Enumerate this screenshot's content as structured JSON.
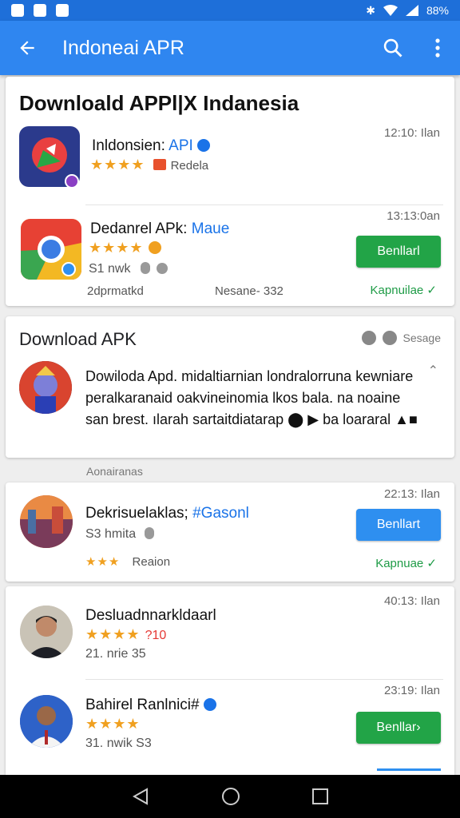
{
  "app_bar": {
    "title": "Indoneai APR"
  },
  "status": {
    "battery": "88%"
  },
  "featured": {
    "heading": "Downloald APPl|X Indanesia",
    "apps": [
      {
        "name": "Inldonsien:",
        "tag": "API",
        "time": "12:10: Ilan",
        "stars": "★★★★",
        "badge": "Redela"
      },
      {
        "name": "Dedanrel APk:",
        "tag": "Maue",
        "time": "13:13:0an",
        "stars": "★★★★",
        "meta": "S1 nwk",
        "installs": "2dprmatkd",
        "version": "Nesane- 332",
        "button": "Benllarl",
        "link": "Kapnuilae ✓"
      }
    ]
  },
  "post": {
    "title": "Download APK",
    "label": "Sesage",
    "text": "Dowiloda Apd. midaltiarnian londralorruna kewniare peralkaranaid oakvineinomia lkos bala. na noaine san brest. ılarah sartaitdiatarap ⬤ ▶ ba loararal ▲■"
  },
  "section_label": "Aonairanas",
  "apps": [
    {
      "name": "Dekrisuelaklas;",
      "tag": "#Gasonl",
      "time": "22:13: Ilan",
      "meta": "S3 hmita",
      "stars": "★★★",
      "reason": "Reaion",
      "button": "Benllart",
      "link": "Kapnuae ✓"
    },
    {
      "name": "Desluadnnarkldaarl",
      "time": "40:13: Ilan",
      "stars": "★★★★",
      "rating": "?10",
      "meta": "21. nrie 35"
    },
    {
      "name": "Bahirel Ranlnici#",
      "time": "23:19: Ilan",
      "stars": "★★★★",
      "meta": "31. nwik S3",
      "button": "Benllar›"
    }
  ],
  "colors": {
    "primary": "#2f86f0",
    "green": "#22a447",
    "star": "#f0a020"
  }
}
